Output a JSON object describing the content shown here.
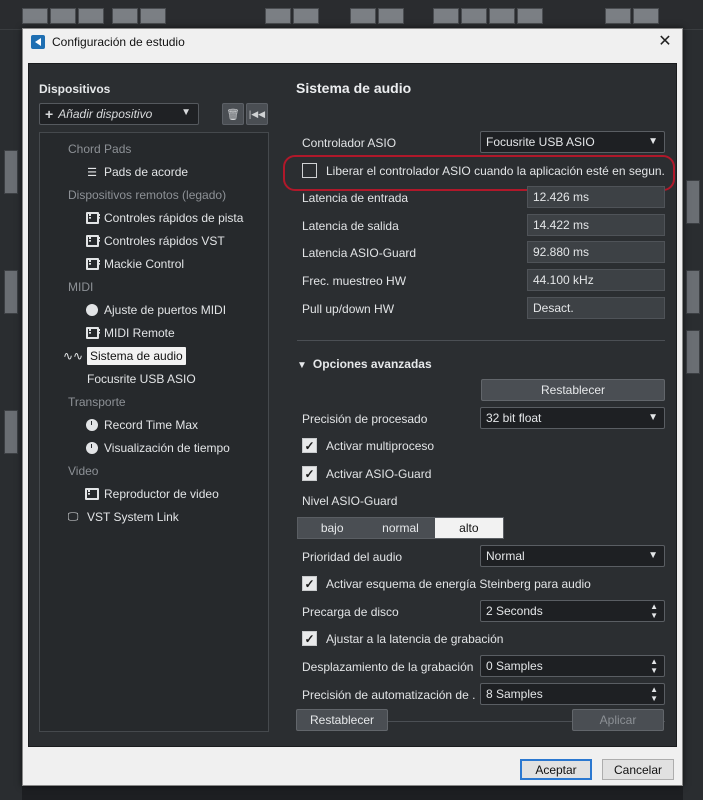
{
  "window": {
    "title": "Configuración de estudio"
  },
  "left": {
    "title": "Dispositivos",
    "add_device": "Añadir dispositivo",
    "tree": [
      {
        "kind": "cat",
        "label": "Chord Pads"
      },
      {
        "kind": "item",
        "label": "Pads de acorde",
        "icon": "chord-pads-icon"
      },
      {
        "kind": "cat",
        "label": "Dispositivos remotos (legado)"
      },
      {
        "kind": "item",
        "label": "Controles rápidos de pista",
        "icon": "controller-icon"
      },
      {
        "kind": "item",
        "label": "Controles rápidos VST",
        "icon": "controller-icon"
      },
      {
        "kind": "item",
        "label": "Mackie Control",
        "icon": "controller-icon"
      },
      {
        "kind": "cat",
        "label": "MIDI"
      },
      {
        "kind": "item",
        "label": "Ajuste de puertos MIDI",
        "icon": "midi-port-icon"
      },
      {
        "kind": "item",
        "label": "MIDI Remote",
        "icon": "controller-icon"
      },
      {
        "kind": "root-selected",
        "label": "Sistema de audio",
        "icon": "waveform-icon"
      },
      {
        "kind": "root-sub",
        "label": "Focusrite USB ASIO"
      },
      {
        "kind": "cat",
        "label": "Transporte"
      },
      {
        "kind": "item",
        "label": "Record Time Max",
        "icon": "clock-icon"
      },
      {
        "kind": "item",
        "label": "Visualización de tiempo",
        "icon": "clock-icon"
      },
      {
        "kind": "cat",
        "label": "Video"
      },
      {
        "kind": "item",
        "label": "Reproductor de video",
        "icon": "video-icon"
      },
      {
        "kind": "root",
        "label": "VST System Link",
        "icon": "monitor-icon"
      }
    ]
  },
  "audio": {
    "title": "Sistema de audio",
    "asio_label": "Controlador ASIO",
    "asio_value": "Focusrite USB ASIO",
    "release_label": "Liberar el controlador ASIO cuando la aplicación esté en segun.",
    "input_latency_label": "Latencia de entrada",
    "input_latency": "12.426 ms",
    "output_latency_label": "Latencia de salida",
    "output_latency": "14.422 ms",
    "asio_guard_latency_label": "Latencia ASIO-Guard",
    "asio_guard_latency": "92.880 ms",
    "hw_rate_label": "Frec. muestreo HW",
    "hw_rate": "44.100 kHz",
    "pull_label": "Pull up/down HW",
    "pull_value": "Desact."
  },
  "advanced": {
    "title": "Opciones avanzadas",
    "reset": "Restablecer",
    "precision_label": "Precisión de procesado",
    "precision_value": "32 bit float",
    "multiprocess": "Activar multiproceso",
    "asio_guard": "Activar ASIO-Guard",
    "asio_guard_level_label": "Nivel ASIO-Guard",
    "levels": [
      "bajo",
      "normal",
      "alto"
    ],
    "audio_priority_label": "Prioridad del audio",
    "audio_priority_value": "Normal",
    "power_scheme": "Activar esquema de energía Steinberg para audio",
    "disk_preload_label": "Precarga de disco",
    "disk_preload_value": "2 Seconds",
    "adjust_latency": "Ajustar a la latencia de grabación",
    "record_offset_label": "Desplazamiento de la grabación",
    "record_offset_value": "0 Samples",
    "automation_label": "Precisión de automatización de .",
    "automation_value": "8 Samples"
  },
  "footer": {
    "reset": "Restablecer",
    "apply": "Aplicar",
    "accept": "Aceptar",
    "cancel": "Cancelar"
  },
  "colors": {
    "highlight_outline": "#b0182a",
    "primary_border": "#2b78d0"
  }
}
